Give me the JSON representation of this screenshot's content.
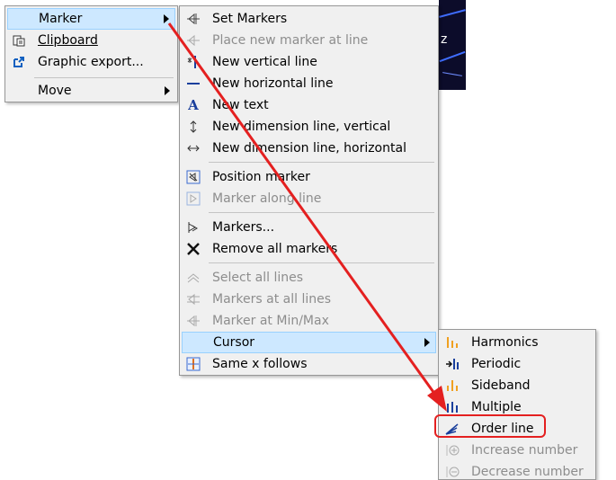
{
  "menu1": {
    "items": [
      {
        "label": "Marker",
        "icon": "none",
        "submenu": true,
        "highlighted": true
      },
      {
        "label": "Clipboard",
        "icon": "clipboard-icon"
      },
      {
        "label": "Graphic export...",
        "icon": "export-icon"
      },
      {
        "label": "Move",
        "icon": "none",
        "submenu": true
      }
    ]
  },
  "menu2": {
    "items": [
      {
        "label": "Set Markers",
        "icon": "set-markers-icon"
      },
      {
        "label": "Place new marker at line",
        "icon": "place-marker-icon",
        "disabled": true
      },
      {
        "label": "New vertical line",
        "icon": "vertical-line-icon"
      },
      {
        "label": "New horizontal line",
        "icon": "horizontal-line-icon"
      },
      {
        "label": "New text",
        "icon": "text-icon"
      },
      {
        "label": "New dimension line, vertical",
        "icon": "dimension-vertical-icon"
      },
      {
        "label": "New dimension line, horizontal",
        "icon": "dimension-horizontal-icon"
      },
      {
        "label": "Position marker",
        "icon": "position-marker-icon"
      },
      {
        "label": "Marker along line",
        "icon": "marker-along-line-icon",
        "disabled": true
      },
      {
        "label": "Markers...",
        "icon": "markers-icon"
      },
      {
        "label": "Remove all markers",
        "icon": "remove-markers-icon"
      },
      {
        "label": "Select all lines",
        "icon": "select-lines-icon",
        "disabled": true
      },
      {
        "label": "Markers at all lines",
        "icon": "markers-all-lines-icon",
        "disabled": true
      },
      {
        "label": "Marker at Min/Max",
        "icon": "marker-minmax-icon",
        "disabled": true
      },
      {
        "label": "Cursor",
        "icon": "none",
        "submenu": true,
        "highlighted": true
      },
      {
        "label": "Same x follows",
        "icon": "same-x-icon"
      }
    ]
  },
  "menu3": {
    "items": [
      {
        "label": "Harmonics",
        "icon": "harmonics-icon"
      },
      {
        "label": "Periodic",
        "icon": "periodic-icon"
      },
      {
        "label": "Sideband",
        "icon": "sideband-icon"
      },
      {
        "label": "Multiple",
        "icon": "multiple-icon"
      },
      {
        "label": "Order line",
        "icon": "order-line-icon"
      },
      {
        "label": "Increase number",
        "icon": "increase-icon",
        "disabled": true
      },
      {
        "label": "Decrease number",
        "icon": "decrease-icon",
        "disabled": true
      }
    ]
  },
  "background_plot": {
    "axis_letter": "z"
  },
  "colors": {
    "menu_bg": "#f0f0f0",
    "highlight": "#cde8ff",
    "annotation": "#e42020",
    "disabled_text": "#8d8d8d"
  }
}
